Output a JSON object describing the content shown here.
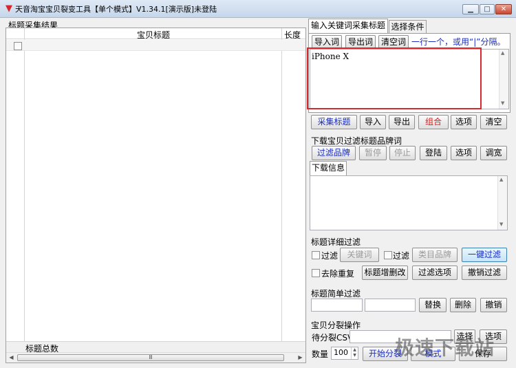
{
  "window": {
    "title": "天音淘宝宝贝裂变工具【单个模式】V1.34.1[演示版]未登陆",
    "minimize_label": "▁",
    "maximize_label": "□",
    "close_label": "✕"
  },
  "left_panel": {
    "section_title": "标题采集结果",
    "col_title": "宝贝标题",
    "col_length": "长度",
    "footer_total": "标题总数",
    "scroll_grip": "Ⅲ"
  },
  "tabs": {
    "keyword_tab": "输入关键词采集标题",
    "options_tab": "选择条件"
  },
  "keyword_panel": {
    "import_words": "导入词",
    "export_words": "导出词",
    "clear_words": "清空词",
    "hint": "一行一个，或用“|”分隔。",
    "textarea_value": "iPhone X"
  },
  "collect_toolbar": {
    "collect_titles": "采集标题",
    "import": "导入",
    "export": "导出",
    "combine": "组合",
    "options": "选项",
    "clear": "清空"
  },
  "brand_filter": {
    "section_title": "下载宝贝过滤标题品牌词",
    "filter_brand": "过滤品牌",
    "pause": "暂停",
    "stop": "停止",
    "login": "登陆",
    "options": "选项",
    "adjust_width": "调宽"
  },
  "download_info": {
    "tab": "下载信息"
  },
  "detail_filter": {
    "section_title": "标题详细过滤",
    "filter1_label": "过滤",
    "keywords_btn": "关键词",
    "filter2_label": "过滤",
    "category_brand_btn": "类目品牌",
    "one_click_filter": "一键过滤",
    "dedupe_label": "去除重复",
    "title_edit_btn": "标题增删改",
    "filter_options_btn": "过滤选项",
    "undo_filter_btn": "撤销过滤"
  },
  "simple_filter": {
    "section_title": "标题简单过滤",
    "replace": "替换",
    "delete": "删除",
    "undo": "撤销"
  },
  "split_ops": {
    "section_title": "宝贝分裂操作",
    "pending_csv_label": "待分裂CSV",
    "select_btn1": "选择",
    "select_btn2": "选项",
    "quantity_label": "数量",
    "quantity_value": "100",
    "start_split": "开始分裂",
    "mode_btn": "模式",
    "save_btn": "保存"
  },
  "watermark": {
    "text": "极速下载站"
  }
}
